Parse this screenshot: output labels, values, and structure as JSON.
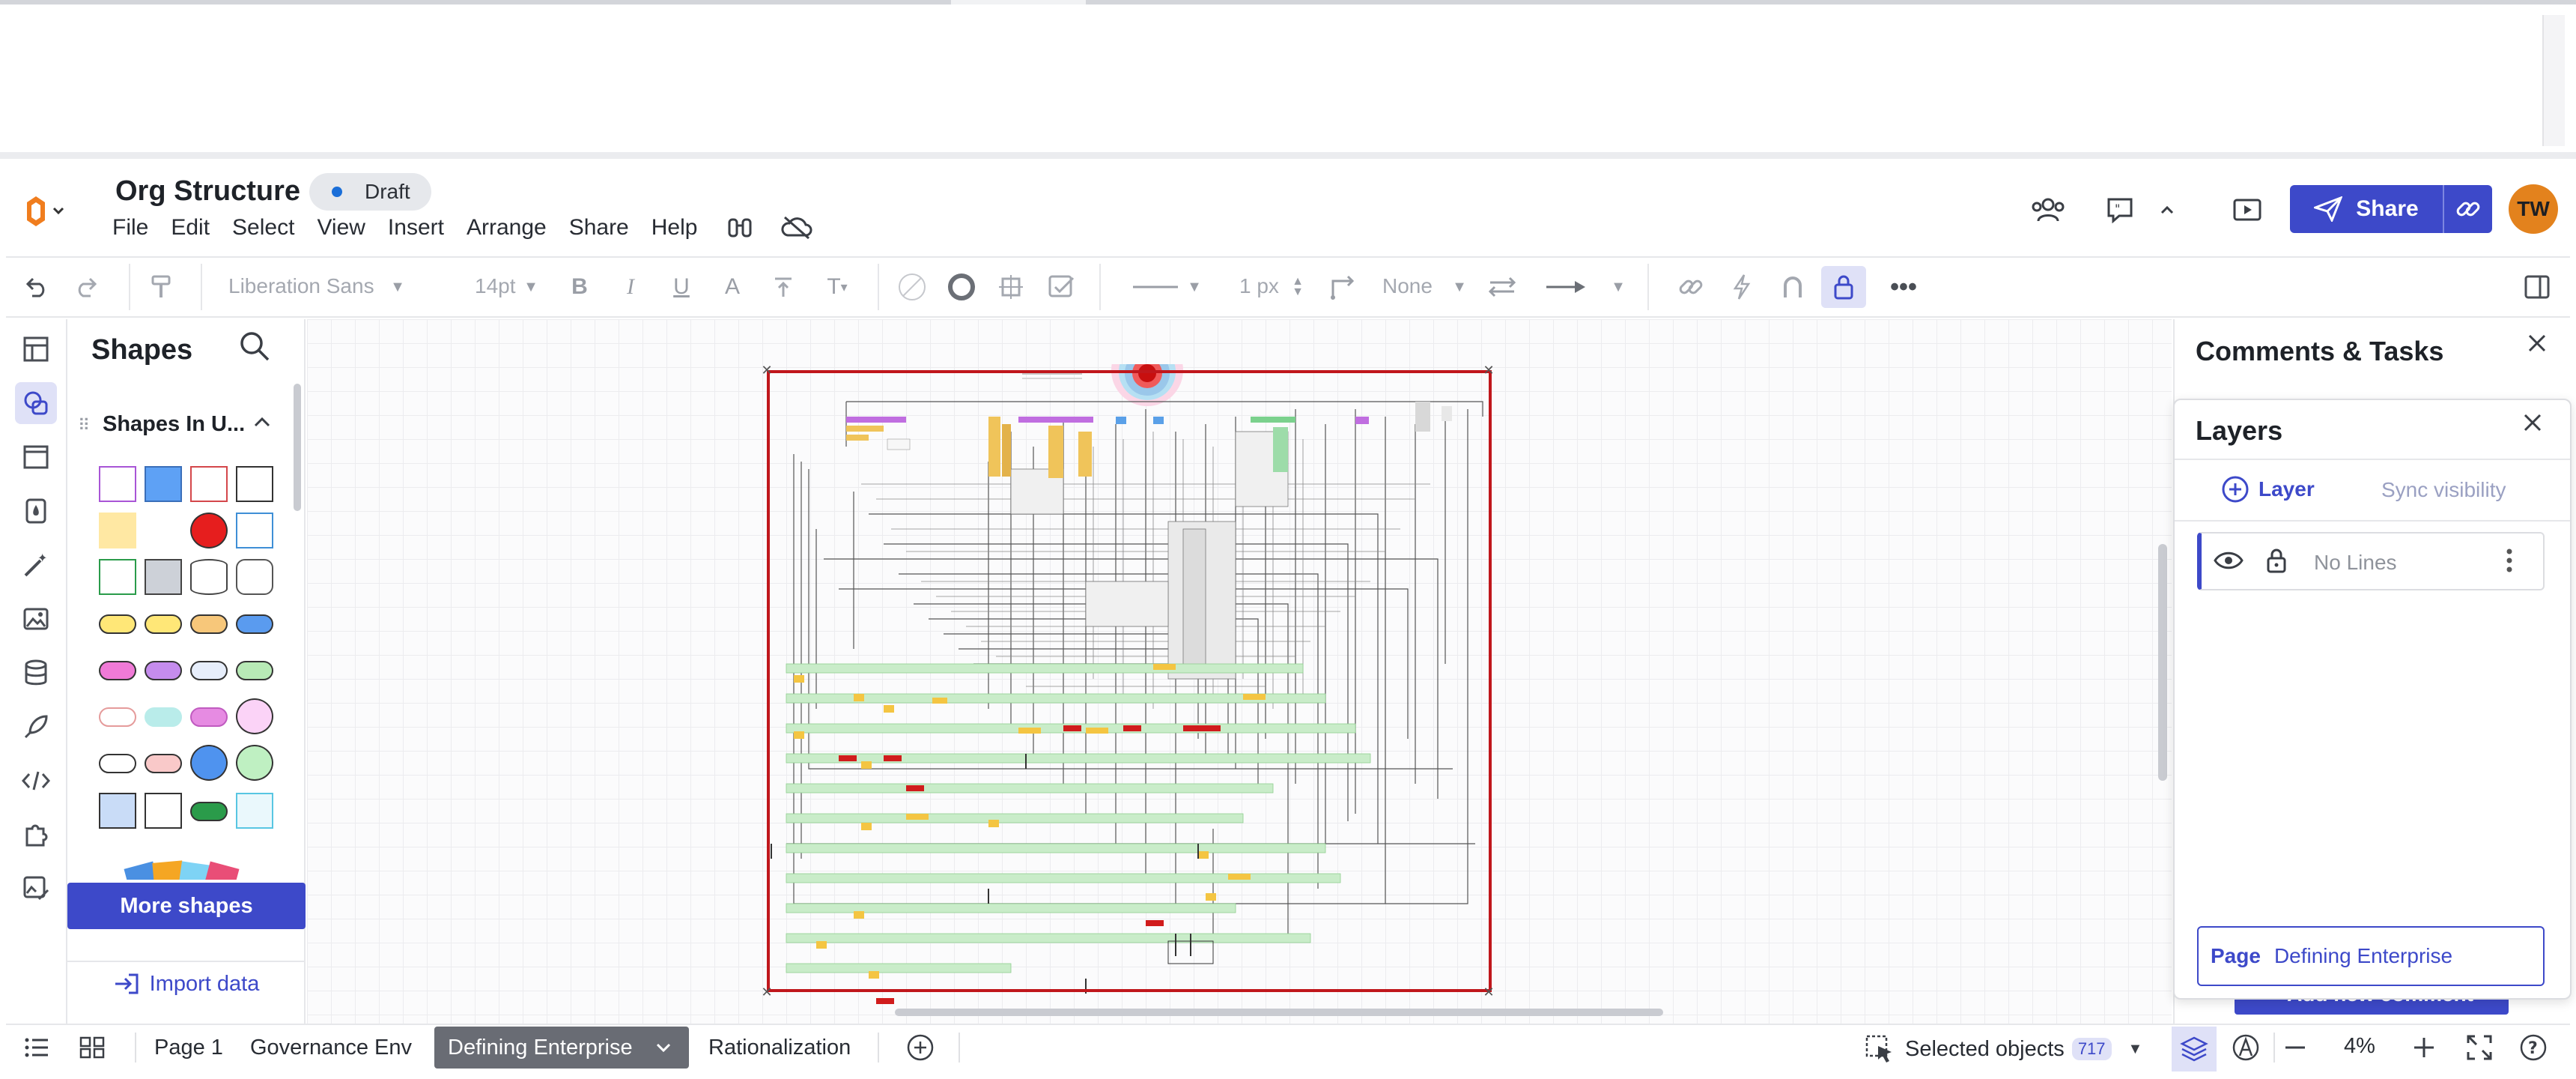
{
  "document": {
    "title": "Org Structure",
    "status": "Draft"
  },
  "menu": [
    "File",
    "Edit",
    "Select",
    "View",
    "Insert",
    "Arrange",
    "Share",
    "Help"
  ],
  "header": {
    "share_label": "Share",
    "avatar_initials": "TW"
  },
  "toolbar": {
    "font_family": "Liberation Sans",
    "font_size": "14pt",
    "line_width": "1 px",
    "arrow_start": "None"
  },
  "shapes_panel": {
    "title": "Shapes",
    "section_title": "Shapes In U...",
    "more_shapes_label": "More shapes",
    "import_data_label": "Import data"
  },
  "comments_panel": {
    "title": "Comments & Tasks",
    "add_comment_label": "+ Add new comment"
  },
  "layers_panel": {
    "title": "Layers",
    "add_layer_label": "Layer",
    "sync_visibility_label": "Sync visibility",
    "layers": [
      {
        "name": "No Lines"
      }
    ],
    "page_label": "Page",
    "page_name": "Defining Enterprise"
  },
  "bottom_bar": {
    "pages": [
      "Page 1",
      "Governance Env",
      "Defining Enterprise",
      "Rationalization"
    ],
    "active_page": "Defining Enterprise",
    "selected_objects_label": "Selected objects",
    "selected_count": "717",
    "zoom": "4%"
  },
  "colors": {
    "accent": "#3d49c9",
    "avatar": "#e3821d",
    "selection_frame": "#c0171c",
    "badge_dot": "#1a6ed8"
  }
}
